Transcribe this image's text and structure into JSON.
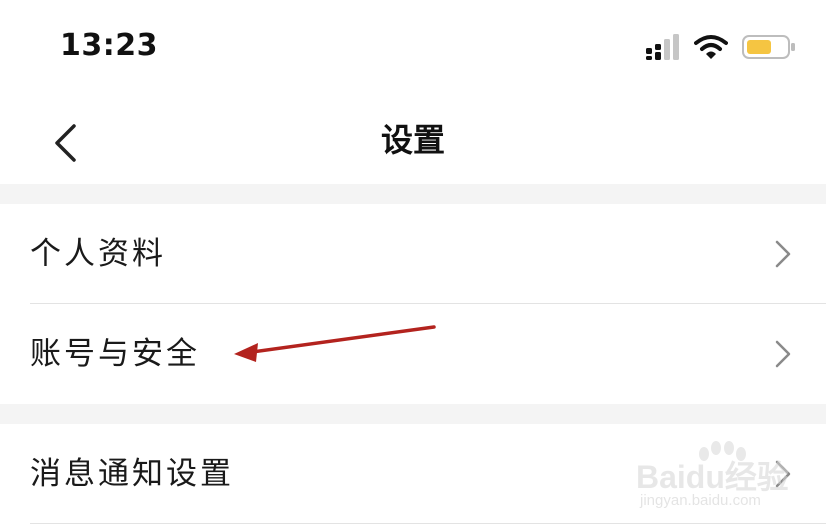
{
  "status_bar": {
    "time": "13:23",
    "icons": [
      "signal-icon",
      "wifi-icon",
      "battery-icon"
    ],
    "battery_color": "#f5c542"
  },
  "nav": {
    "title": "设置",
    "back_icon": "chevron-left-icon"
  },
  "settings": {
    "items": [
      {
        "label": "个人资料",
        "icon": "chevron-right-icon"
      },
      {
        "label": "账号与安全",
        "icon": "chevron-right-icon"
      },
      {
        "label": "消息通知设置",
        "icon": "chevron-right-icon"
      }
    ]
  },
  "annotation": {
    "type": "arrow",
    "points_to": "账号与安全",
    "color": "#b3231e"
  },
  "watermark": {
    "text": "Baidu经验",
    "sub": "jingyan.baidu.com"
  }
}
